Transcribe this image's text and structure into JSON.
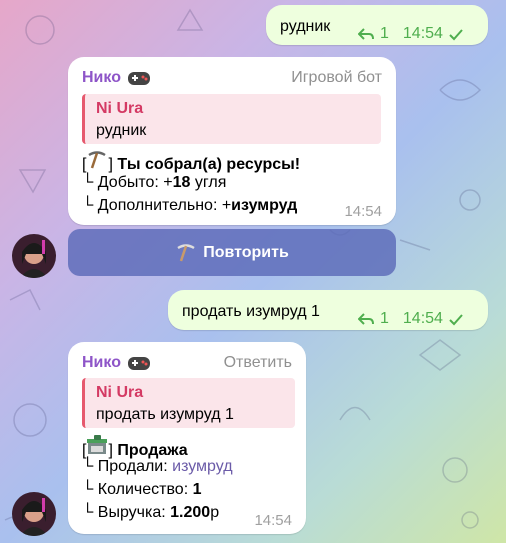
{
  "msg1": {
    "text": "рудник",
    "reply_count": "1",
    "time": "14:54"
  },
  "bot1": {
    "sender": "Нико",
    "label": "Игровой бот",
    "quote_name": "Ni Ura",
    "quote_text": "рудник",
    "line1_prefix": "[",
    "line1_suffix": "]",
    "line1_bold": "Ты собрал(а) ресурсы!",
    "line2_prefix": "└ Добыто: +",
    "line2_bold": "18",
    "line2_suffix": " угля",
    "line3_prefix": "└ Дополнительно: +",
    "line3_bold": "изумруд",
    "time": "14:54"
  },
  "button": {
    "label": "Повторить"
  },
  "msg2": {
    "text": "продать изумруд 1",
    "reply_count": "1",
    "time": "14:54"
  },
  "bot2": {
    "sender": "Нико",
    "label": "Ответить",
    "quote_name": "Ni Ura",
    "quote_text": "продать изумруд 1",
    "line1_prefix": "[",
    "line1_suffix": "]",
    "line1_bold": "Продажа",
    "line2_prefix": "└ Продали: ",
    "line2_item": "изумруд",
    "line3_prefix": "└ Количество: ",
    "line3_bold": "1",
    "line4_prefix": "└ Выручка: ",
    "line4_bold": "1.200",
    "line4_suffix": "р",
    "time": "14:54"
  },
  "icons": [
    "reply-icon",
    "double-check-icon",
    "gamepad-icon",
    "pickaxe-icon",
    "store-icon",
    "avatar"
  ]
}
